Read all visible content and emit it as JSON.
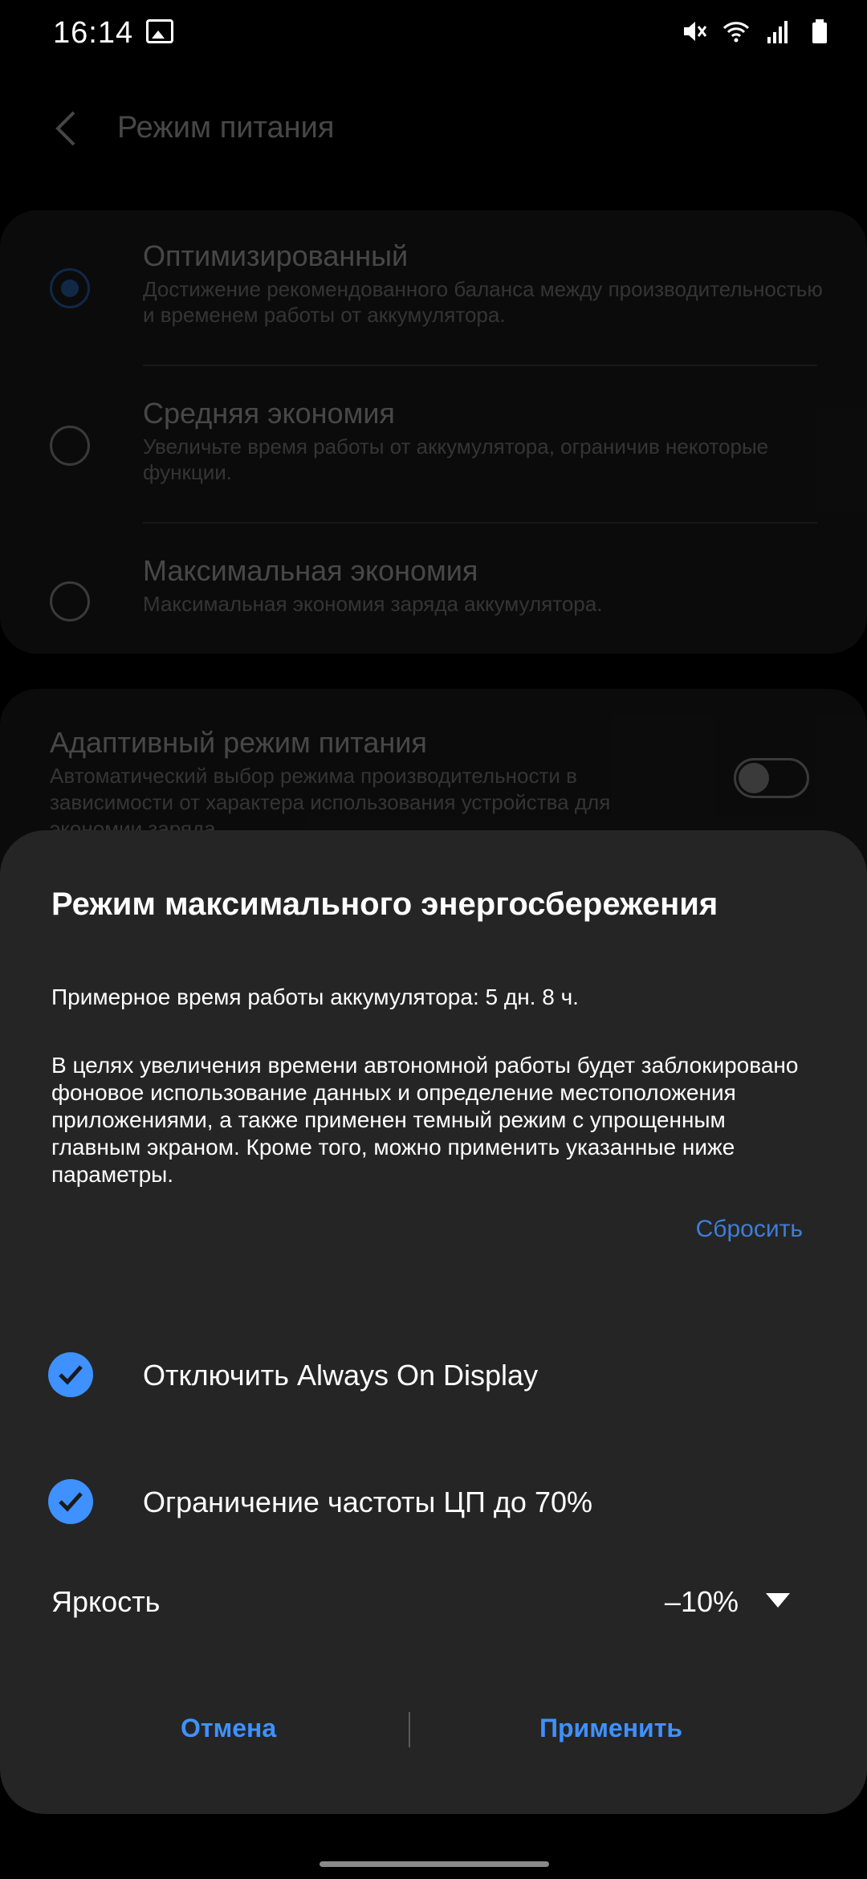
{
  "status_bar": {
    "time": "16:14"
  },
  "header": {
    "title": "Режим питания"
  },
  "power_modes": [
    {
      "title": "Оптимизированный",
      "description": "Достижение рекомендованного баланса между производительностью и временем работы от аккумулятора.",
      "selected": true
    },
    {
      "title": "Средняя экономия",
      "description": "Увеличьте время работы от аккумулятора, ограничив некоторые функции.",
      "selected": false
    },
    {
      "title": "Максимальная экономия",
      "description": "Максимальная экономия заряда аккумулятора.",
      "selected": false
    }
  ],
  "adaptive": {
    "title": "Адаптивный режим питания",
    "description": "Автоматический выбор режима производительности в зависимости от характера использования устройства для экономии заряда",
    "enabled": false
  },
  "dialog": {
    "title": "Режим максимального энергосбережения",
    "estimate": "Примерное время работы аккумулятора: 5 дн. 8 ч.",
    "body": "В целях увеличения времени автономной работы будет заблокировано фоновое использование данных и определение местоположения приложениями, а также применен темный режим с упрощенным главным экраном. Кроме того, можно применить указанные ниже параметры.",
    "reset_label": "Сбросить",
    "options": [
      {
        "label": "Отключить Always On Display",
        "checked": true
      },
      {
        "label": "Ограничение частоты ЦП до 70%",
        "checked": true
      }
    ],
    "brightness_label": "Яркость",
    "brightness_value": "–10%",
    "cancel_label": "Отмена",
    "apply_label": "Применить"
  },
  "colors": {
    "accent": "#3e91ff",
    "dialog_bg": "#252525",
    "card_bg": "#2a2a2a"
  }
}
